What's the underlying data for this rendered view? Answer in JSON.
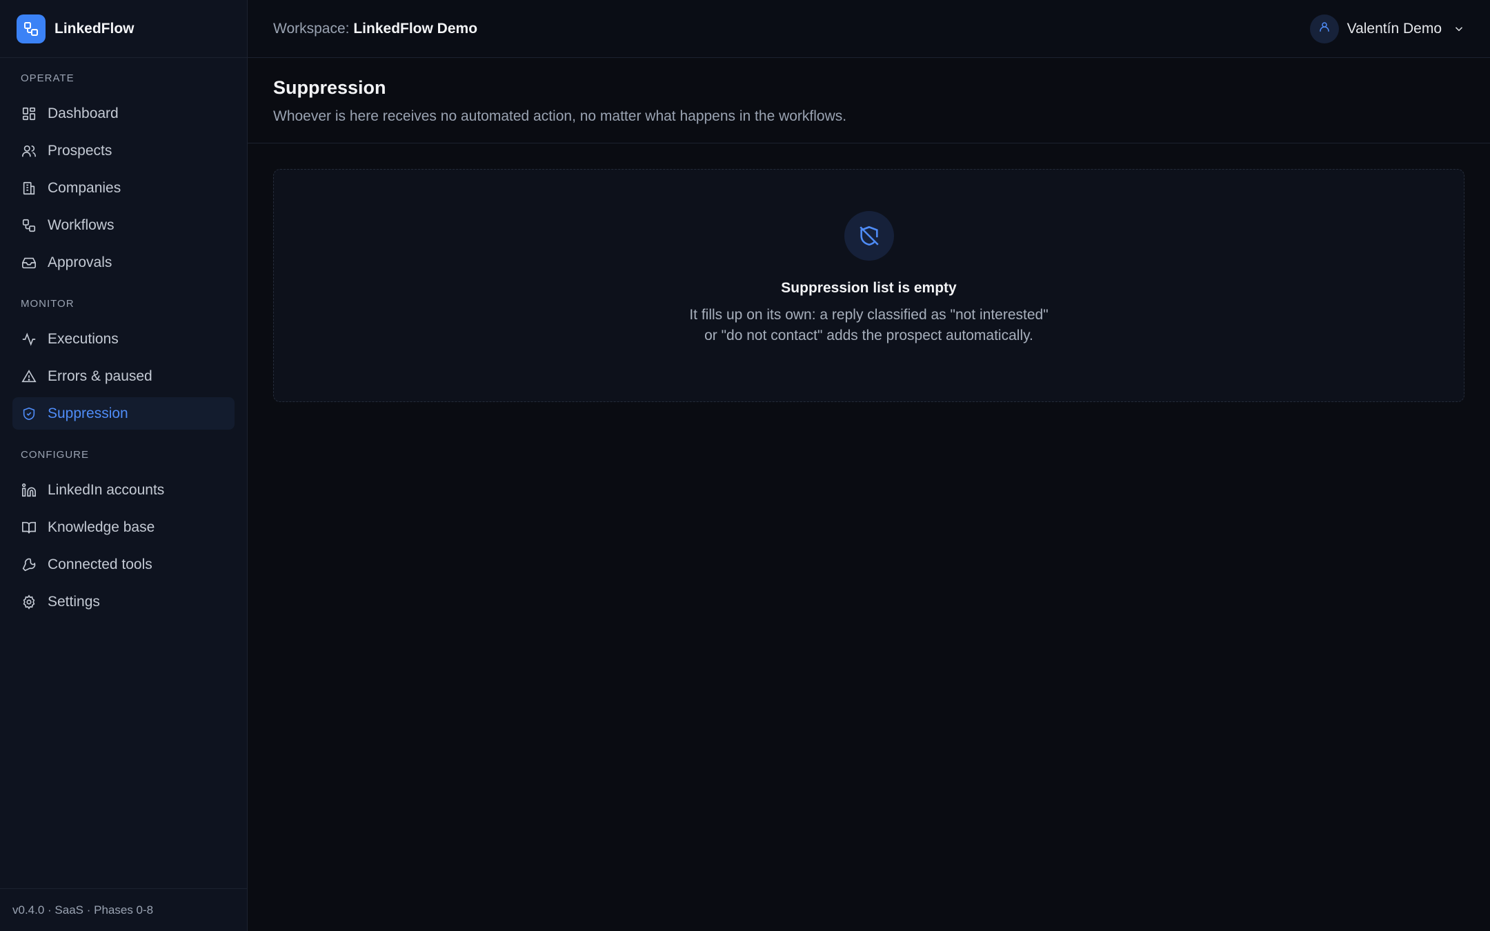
{
  "brand": {
    "name": "LinkedFlow",
    "accent": "#3b82f6"
  },
  "sidebar": {
    "sections": [
      {
        "title": "OPERATE",
        "items": [
          {
            "label": "Dashboard",
            "icon": "dashboard-icon"
          },
          {
            "label": "Prospects",
            "icon": "users-icon"
          },
          {
            "label": "Companies",
            "icon": "building-icon"
          },
          {
            "label": "Workflows",
            "icon": "workflow-icon"
          },
          {
            "label": "Approvals",
            "icon": "inbox-icon"
          }
        ]
      },
      {
        "title": "MONITOR",
        "items": [
          {
            "label": "Executions",
            "icon": "activity-icon"
          },
          {
            "label": "Errors & paused",
            "icon": "warning-icon"
          },
          {
            "label": "Suppression",
            "icon": "shield-check-icon",
            "active": true
          }
        ]
      },
      {
        "title": "CONFIGURE",
        "items": [
          {
            "label": "LinkedIn accounts",
            "icon": "linkedin-icon"
          },
          {
            "label": "Knowledge base",
            "icon": "book-icon"
          },
          {
            "label": "Connected tools",
            "icon": "wrench-icon"
          },
          {
            "label": "Settings",
            "icon": "gear-icon"
          }
        ]
      }
    ],
    "footer": "v0.4.0 · SaaS · Phases 0-8"
  },
  "topbar": {
    "workspace_label": "Workspace:",
    "workspace_name": "LinkedFlow Demo",
    "user_name": "Valentín Demo"
  },
  "page": {
    "title": "Suppression",
    "subtitle": "Whoever is here receives no automated action, no matter what happens in the workflows."
  },
  "empty_state": {
    "icon": "shield-off-icon",
    "title": "Suppression list is empty",
    "line1": "It fills up on its own: a reply classified as \"not interested\"",
    "line2": "or \"do not contact\" adds the prospect automatically."
  }
}
